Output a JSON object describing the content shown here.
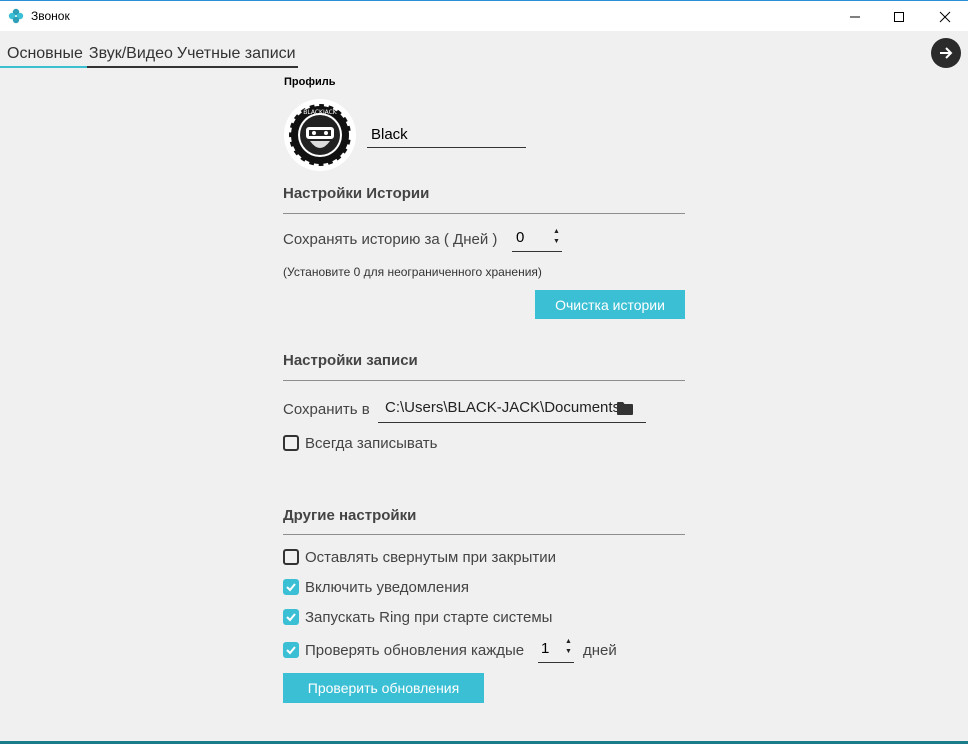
{
  "window": {
    "title": "Звонок",
    "controls": {
      "minimize": "minimize-icon",
      "maximize": "maximize-icon",
      "close": "close-icon"
    }
  },
  "tabs": [
    {
      "label": "Основные",
      "active": true
    },
    {
      "label": "Звук/Видео",
      "active": false
    },
    {
      "label": "Учетные записи",
      "active": false
    }
  ],
  "profile": {
    "heading": "Профиль",
    "name": "Black",
    "avatar_text": "BLACKJACK"
  },
  "history": {
    "title": "Настройки Истории",
    "keep_label": "Сохранять историю  за ( Дней )",
    "days_value": "0",
    "hint": "(Установите 0 для неограниченного хранения)",
    "clear_button": "Очистка истории"
  },
  "recording": {
    "title": "Настройки записи",
    "save_label": "Сохранить в",
    "path": "C:\\Users\\BLACK-JACK\\Documents",
    "always_record_label": "Всегда записывать",
    "always_record_checked": false
  },
  "other": {
    "title": "Другие настройки",
    "minimized_label": "Оставлять свернутым при закрытии",
    "minimized_checked": false,
    "notifications_label": "Включить уведомления",
    "notifications_checked": true,
    "autostart_label": "Запускать Ring при старте системы",
    "autostart_checked": true,
    "update_check_label": "Проверять обновления каждые",
    "update_interval": "1",
    "update_unit": "дней",
    "update_check_checked": true,
    "check_updates_button": "Проверить обновления"
  },
  "colors": {
    "accent": "#3bbfd4",
    "title_bar": "#ffffff",
    "background": "#f0f0f0",
    "bottom_border": "#1a7c8a"
  }
}
